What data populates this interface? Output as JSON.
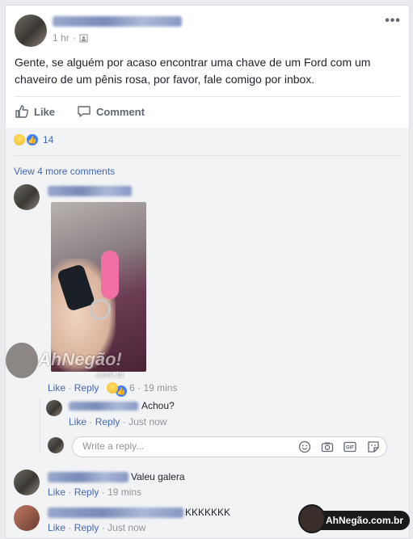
{
  "post": {
    "time": "1 hr",
    "text": "Gente, se alguém por acaso encontrar uma chave de um Ford com um chaveiro de um pênis rosa, por favor, fale comigo por inbox.",
    "actions": {
      "like_label": "Like",
      "comment_label": "Comment"
    },
    "reactions": {
      "count": "14",
      "icons": [
        "haha-icon",
        "like-icon"
      ]
    },
    "menu_icon": "more-icon"
  },
  "comments": {
    "view_more": "View 4 more comments",
    "items": [
      {
        "has_photo": true,
        "actions": {
          "like": "Like",
          "reply": "Reply",
          "reaction_count": "6",
          "time": "19 mins"
        },
        "replies": [
          {
            "text": "Achou?",
            "actions": {
              "like": "Like",
              "reply": "Reply",
              "time": "Just now"
            }
          }
        ],
        "reply_input": {
          "placeholder": "Write a reply...",
          "tools": [
            "emoji-icon",
            "camera-icon",
            "gif-icon",
            "sticker-icon"
          ]
        }
      },
      {
        "text": "Valeu galera",
        "actions": {
          "like": "Like",
          "reply": "Reply",
          "time": "19 mins"
        }
      },
      {
        "text": "KKKKKKK",
        "actions": {
          "like": "Like",
          "reply": "Reply",
          "time": "Just now"
        }
      }
    ]
  },
  "watermark": {
    "overlay_text": "AhNegão!",
    "overlay_sub": ".com.br",
    "badge_text": "AhNegão.com.br"
  },
  "colors": {
    "link": "#4267b2",
    "muted": "#90949c",
    "background": "#e9ebee"
  }
}
